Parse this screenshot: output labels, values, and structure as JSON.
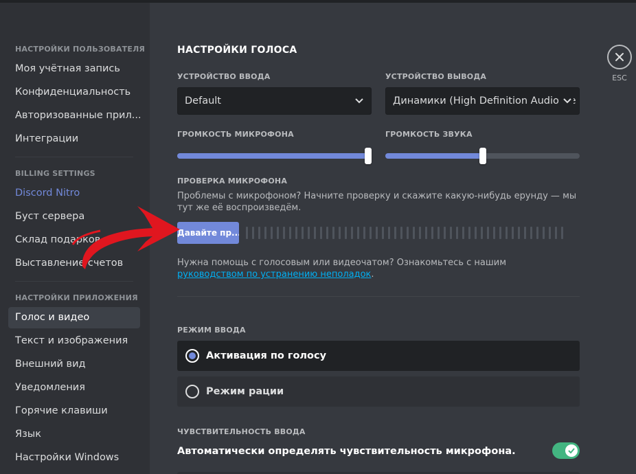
{
  "sidebar": {
    "sections": [
      {
        "heading": "НАСТРОЙКИ ПОЛЬЗОВАТЕЛЯ",
        "items": [
          "Моя учётная запись",
          "Конфиденциальность",
          "Авторизованные прил...",
          "Интеграции"
        ]
      },
      {
        "heading": "BILLING SETTINGS",
        "items": [
          "Discord Nitro",
          "Буст сервера",
          "Склад подарков",
          "Выставление счетов"
        ]
      },
      {
        "heading": "НАСТРОЙКИ ПРИЛОЖЕНИЯ",
        "items": [
          "Голос и видео",
          "Текст и изображения",
          "Внешний вид",
          "Уведомления",
          "Горячие клавиши",
          "Язык",
          "Настройки Windows"
        ]
      }
    ],
    "active_item": "Голос и видео"
  },
  "main": {
    "title": "НАСТРОЙКИ ГОЛОСА",
    "input_device": {
      "label": "УСТРОЙСТВО ВВОДА",
      "value": "Default"
    },
    "output_device": {
      "label": "УСТРОЙСТВО ВЫВОДА",
      "value": "Динамики (High Definition Audio De"
    },
    "mic_volume": {
      "label": "ГРОМКОСТЬ МИКРОФОНА",
      "percent": 100
    },
    "sound_volume": {
      "label": "ГРОМКОСТЬ ЗВУКА",
      "percent": 50
    },
    "mic_test": {
      "label": "ПРОВЕРКА МИКРОФОНА",
      "description": "Проблемы с микрофоном? Начните проверку и скажите какую-нибудь ерунду — мы тут же её воспроизведём.",
      "button": "Давайте пр..."
    },
    "help": {
      "text": "Нужна помощь с голосовым или видеочатом? Ознакомьтесь с нашим ",
      "link": "руководством по устранению неполадок",
      "suffix": "."
    },
    "input_mode": {
      "label": "РЕЖИМ ВВОДА",
      "options": [
        "Активация по голосу",
        "Режим рации"
      ],
      "selected": "Активация по голосу"
    },
    "sensitivity": {
      "label": "ЧУВСТВИТЕЛЬНОСТЬ ВВОДА",
      "auto_label": "Автоматически определять чувствительность микрофона.",
      "auto_enabled": true
    },
    "close": {
      "icon": "close-icon",
      "label": "ESC"
    }
  },
  "colors": {
    "accent": "#7289da",
    "toggle_on": "#43b581",
    "link": "#00b0f4",
    "annotation_arrow": "#e0161f"
  }
}
